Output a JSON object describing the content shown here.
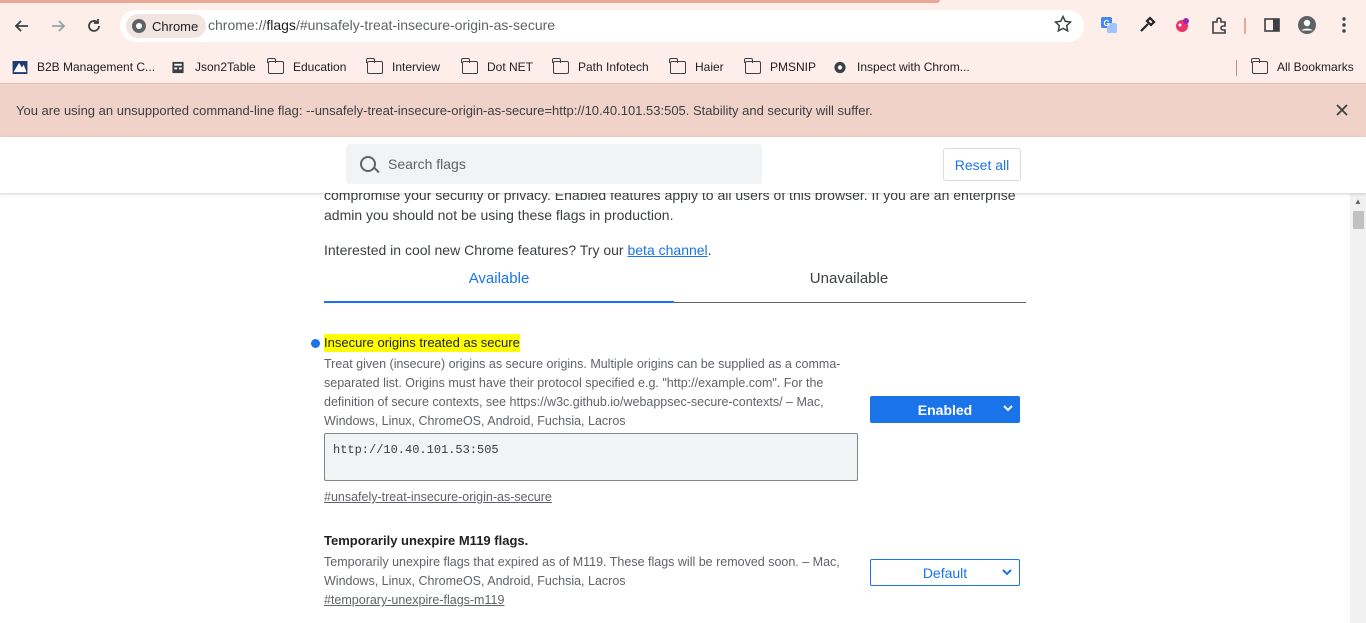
{
  "toolbar": {
    "chip_label": "Chrome",
    "url_scheme": "chrome://",
    "url_host": "flags",
    "url_path": "/#unsafely-treat-insecure-origin-as-secure"
  },
  "bookmarks": {
    "items": [
      {
        "label": "B2B Management C...",
        "icon": "app-icon"
      },
      {
        "label": "Json2Table",
        "icon": "page-icon"
      },
      {
        "label": "Education",
        "icon": "folder-icon"
      },
      {
        "label": "Interview",
        "icon": "folder-icon"
      },
      {
        "label": "Dot NET",
        "icon": "folder-icon"
      },
      {
        "label": "Path Infotech",
        "icon": "folder-icon"
      },
      {
        "label": "Haier",
        "icon": "folder-icon"
      },
      {
        "label": "PMSNIP",
        "icon": "folder-icon"
      },
      {
        "label": "Inspect with Chrom...",
        "icon": "globe-icon"
      }
    ],
    "all_bookmarks": "All Bookmarks"
  },
  "infobar": {
    "message": "You are using an unsupported command-line flag: --unsafely-treat-insecure-origin-as-secure=http://10.40.101.53:505. Stability and security will suffer."
  },
  "header": {
    "search_placeholder": "Search flags",
    "reset_label": "Reset all"
  },
  "intro": {
    "warning_line1": "compromise your security or privacy. Enabled features apply to all users of this browser. If you are an enterprise",
    "warning_line2": "admin you should not be using these flags in production.",
    "beta_prefix": "Interested in cool new Chrome features? Try our ",
    "beta_link": "beta channel",
    "beta_suffix": "."
  },
  "tabs": {
    "available": "Available",
    "unavailable": "Unavailable"
  },
  "experiments": [
    {
      "title": "Insecure origins treated as secure",
      "description": "Treat given (insecure) origins as secure origins. Multiple origins can be supplied as a comma-separated list. Origins must have their protocol specified e.g. \"http://example.com\". For the definition of secure contexts, see https://w3c.github.io/webappsec-secure-contexts/ – Mac, Windows, Linux, ChromeOS, Android, Fuchsia, Lacros",
      "origins_value": "http://10.40.101.53:505",
      "permalink": "#unsafely-treat-insecure-origin-as-secure",
      "state": "Enabled"
    },
    {
      "title": "Temporarily unexpire M119 flags.",
      "description": "Temporarily unexpire flags that expired as of M119. These flags will be removed soon. – Mac, Windows, Linux, ChromeOS, Android, Fuchsia, Lacros",
      "permalink": "#temporary-unexpire-flags-m119",
      "state": "Default"
    }
  ],
  "colors": {
    "accent": "#1a73e8",
    "highlight": "#ffff00",
    "infobar": "#f0d2c8",
    "toolbar": "#fdeee9"
  }
}
